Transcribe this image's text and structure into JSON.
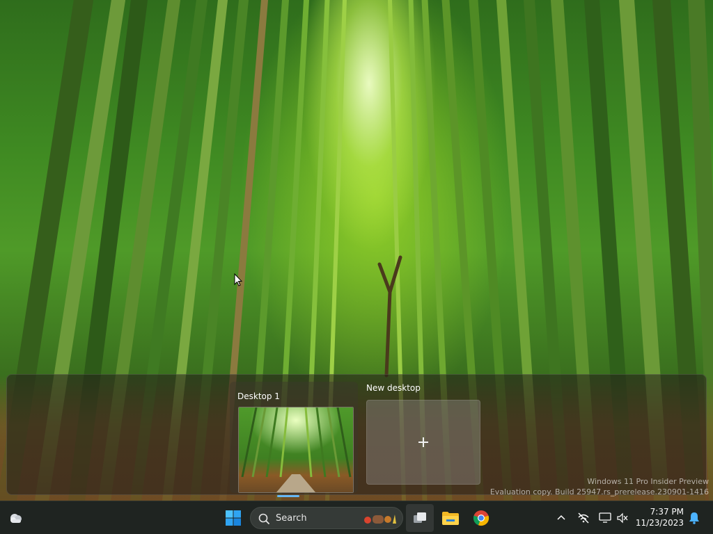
{
  "task_view": {
    "desktops": [
      {
        "label": "Desktop 1"
      }
    ],
    "new_desktop_label": "New desktop"
  },
  "watermark": {
    "line1": "Windows 11 Pro Insider Preview",
    "line2": "Evaluation copy. Build 25947.rs_prerelease.230901-1416"
  },
  "taskbar": {
    "search_placeholder": "Search",
    "pinned_apps": [
      "task-view",
      "file-explorer",
      "google-chrome"
    ],
    "clock": {
      "time": "7:37 PM",
      "date": "11/23/2023"
    },
    "tray_icons": [
      "chevron-up-icon",
      "network-disconnected-icon",
      "display-icon",
      "volume-muted-icon",
      "bell-icon"
    ]
  },
  "colors": {
    "taskbar_bg": "#1f2421",
    "accent": "#67b7f4",
    "start_blue": "#2f8fe8"
  }
}
